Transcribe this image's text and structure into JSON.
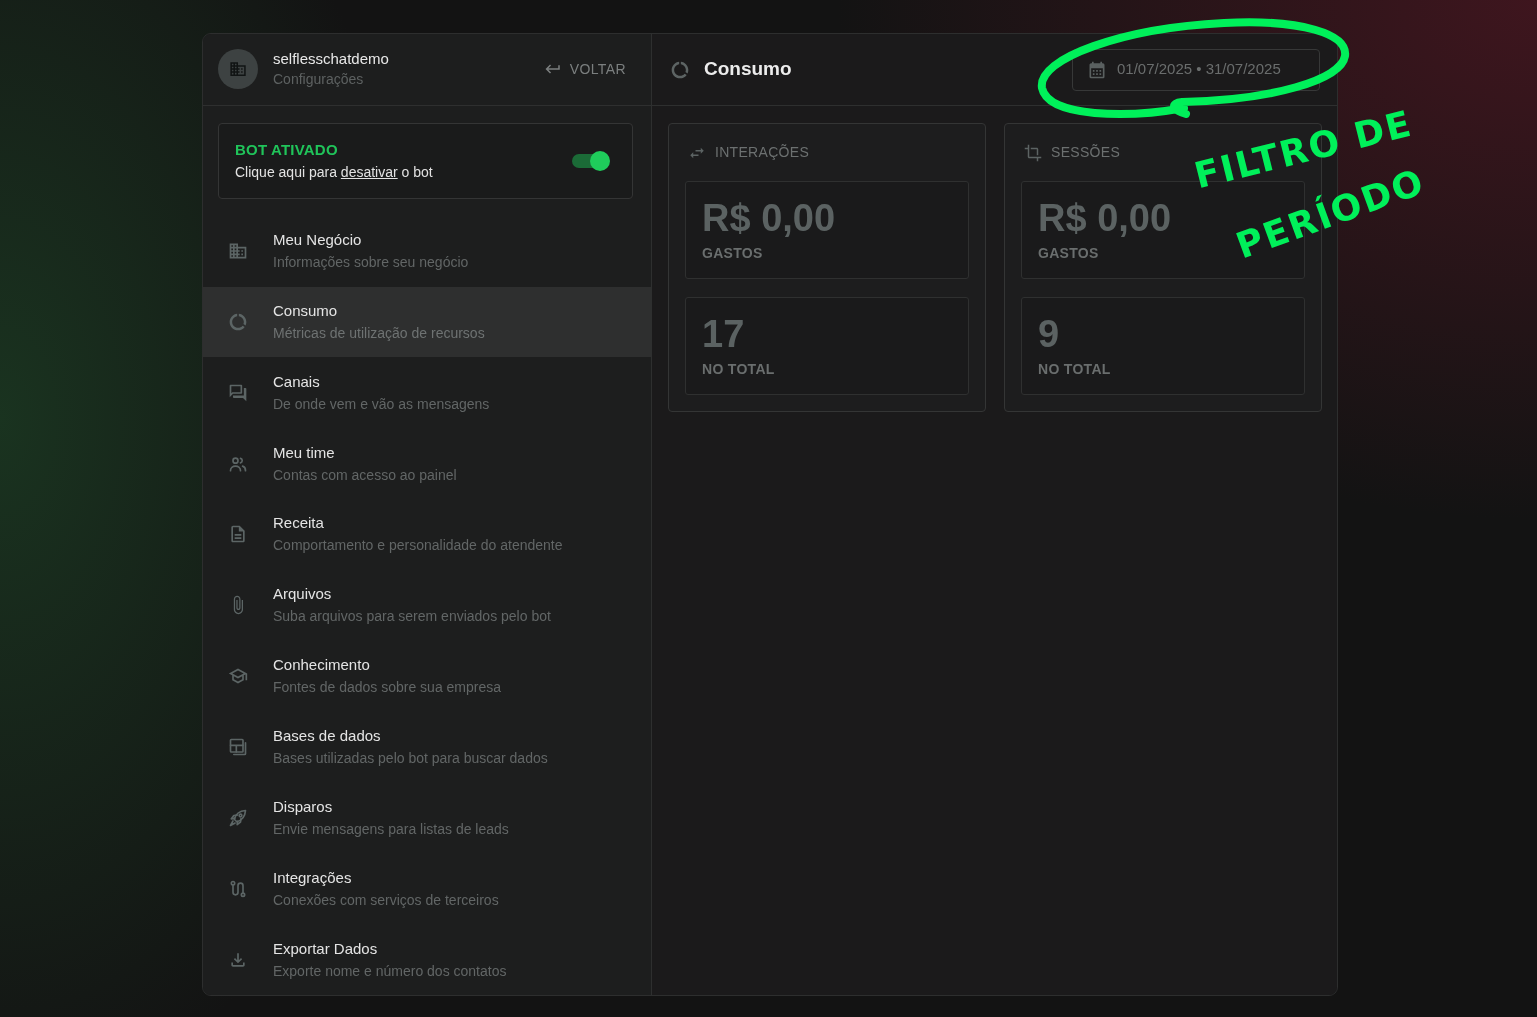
{
  "sidebar": {
    "account": {
      "name": "selflesschatdemo",
      "subtitle": "Configurações"
    },
    "back_button": {
      "label": "VOLTAR"
    },
    "bot_status": {
      "title": "BOT ATIVADO",
      "text_before": "Clique aqui para",
      "link": "desativar",
      "text_after": "o bot",
      "on": true
    },
    "items": [
      {
        "title": "Meu Negócio",
        "subtitle": "Informações sobre seu negócio",
        "selected": false
      },
      {
        "title": "Consumo",
        "subtitle": "Métricas de utilização de recursos",
        "selected": true
      },
      {
        "title": "Canais",
        "subtitle": "De onde vem e vão as mensagens",
        "selected": false
      },
      {
        "title": "Meu time",
        "subtitle": "Contas com acesso ao painel",
        "selected": false
      },
      {
        "title": "Receita",
        "subtitle": "Comportamento e personalidade do atendente",
        "selected": false
      },
      {
        "title": "Arquivos",
        "subtitle": "Suba arquivos para serem enviados pelo bot",
        "selected": false
      },
      {
        "title": "Conhecimento",
        "subtitle": "Fontes de dados sobre sua empresa",
        "selected": false
      },
      {
        "title": "Bases de dados",
        "subtitle": "Bases utilizadas pelo bot para buscar dados",
        "selected": false
      },
      {
        "title": "Disparos",
        "subtitle": "Envie mensagens para listas de leads",
        "selected": false
      },
      {
        "title": "Integrações",
        "subtitle": "Conexões com serviços de terceiros",
        "selected": false
      },
      {
        "title": "Exportar Dados",
        "subtitle": "Exporte nome e número dos contatos",
        "selected": false
      }
    ]
  },
  "main": {
    "title": "Consumo",
    "date_range": {
      "value": "01/07/2025 • 31/07/2025"
    },
    "cards": [
      {
        "title": "INTERAÇÕES",
        "metrics": [
          {
            "value": "R$ 0,00",
            "label": "GASTOS"
          },
          {
            "value": "17",
            "label": "NO TOTAL"
          }
        ]
      },
      {
        "title": "SESSÕES",
        "metrics": [
          {
            "value": "R$ 0,00",
            "label": "GASTOS"
          },
          {
            "value": "9",
            "label": "NO TOTAL"
          }
        ]
      }
    ]
  },
  "annotation": {
    "lines": [
      "FILTRO DE",
      "PERÍODO"
    ]
  }
}
